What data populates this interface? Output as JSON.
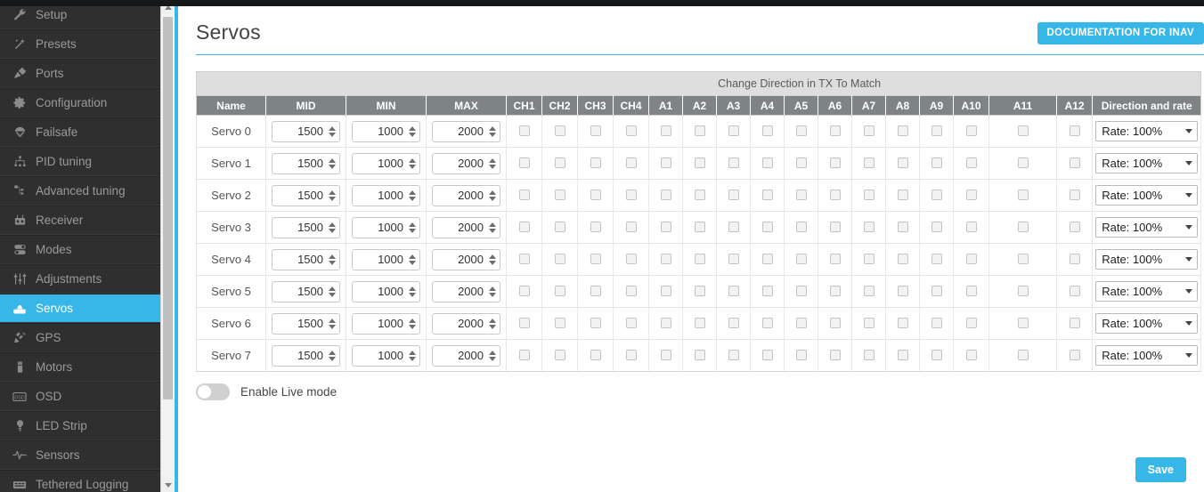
{
  "sidebar": {
    "items": [
      {
        "label": "Setup",
        "icon": "wrench-icon",
        "active": false
      },
      {
        "label": "Presets",
        "icon": "magic-wand-icon",
        "active": false
      },
      {
        "label": "Ports",
        "icon": "plug-icon",
        "active": false
      },
      {
        "label": "Configuration",
        "icon": "gear-icon",
        "active": false
      },
      {
        "label": "Failsafe",
        "icon": "parachute-icon",
        "active": false
      },
      {
        "label": "PID tuning",
        "icon": "sliders-icon",
        "active": false
      },
      {
        "label": "Advanced tuning",
        "icon": "hierarchy-icon",
        "active": false
      },
      {
        "label": "Receiver",
        "icon": "transmitter-icon",
        "active": false
      },
      {
        "label": "Modes",
        "icon": "toggles-icon",
        "active": false
      },
      {
        "label": "Adjustments",
        "icon": "faders-icon",
        "active": false
      },
      {
        "label": "Servos",
        "icon": "servo-icon",
        "active": true
      },
      {
        "label": "GPS",
        "icon": "satellite-icon",
        "active": false
      },
      {
        "label": "Motors",
        "icon": "motor-icon",
        "active": false
      },
      {
        "label": "OSD",
        "icon": "osd-icon",
        "active": false
      },
      {
        "label": "LED Strip",
        "icon": "led-icon",
        "active": false
      },
      {
        "label": "Sensors",
        "icon": "waveform-icon",
        "active": false
      },
      {
        "label": "Tethered Logging",
        "icon": "logging-icon",
        "active": false
      }
    ]
  },
  "header": {
    "title": "Servos",
    "doc_button": "DOCUMENTATION FOR INAV"
  },
  "table": {
    "banner": "Change Direction in TX To Match",
    "columns": [
      "Name",
      "MID",
      "MIN",
      "MAX",
      "CH1",
      "CH2",
      "CH3",
      "CH4",
      "A1",
      "A2",
      "A3",
      "A4",
      "A5",
      "A6",
      "A7",
      "A8",
      "A9",
      "A10",
      "A11",
      "A12",
      "Direction and rate"
    ],
    "rows": [
      {
        "name": "Servo 0",
        "mid": "1500",
        "min": "1000",
        "max": "2000",
        "rate": "Rate: 100%"
      },
      {
        "name": "Servo 1",
        "mid": "1500",
        "min": "1000",
        "max": "2000",
        "rate": "Rate: 100%"
      },
      {
        "name": "Servo 2",
        "mid": "1500",
        "min": "1000",
        "max": "2000",
        "rate": "Rate: 100%"
      },
      {
        "name": "Servo 3",
        "mid": "1500",
        "min": "1000",
        "max": "2000",
        "rate": "Rate: 100%"
      },
      {
        "name": "Servo 4",
        "mid": "1500",
        "min": "1000",
        "max": "2000",
        "rate": "Rate: 100%"
      },
      {
        "name": "Servo 5",
        "mid": "1500",
        "min": "1000",
        "max": "2000",
        "rate": "Rate: 100%"
      },
      {
        "name": "Servo 6",
        "mid": "1500",
        "min": "1000",
        "max": "2000",
        "rate": "Rate: 100%"
      },
      {
        "name": "Servo 7",
        "mid": "1500",
        "min": "1000",
        "max": "2000",
        "rate": "Rate: 100%"
      }
    ],
    "channel_count": 16
  },
  "live_mode": {
    "label": "Enable Live mode",
    "enabled": false
  },
  "footer": {
    "save_label": "Save"
  },
  "colors": {
    "accent": "#37b6e8",
    "sidebar_bg": "#2f2f2f",
    "header_row_bg": "#7e8386",
    "banner_bg": "#dedede"
  }
}
